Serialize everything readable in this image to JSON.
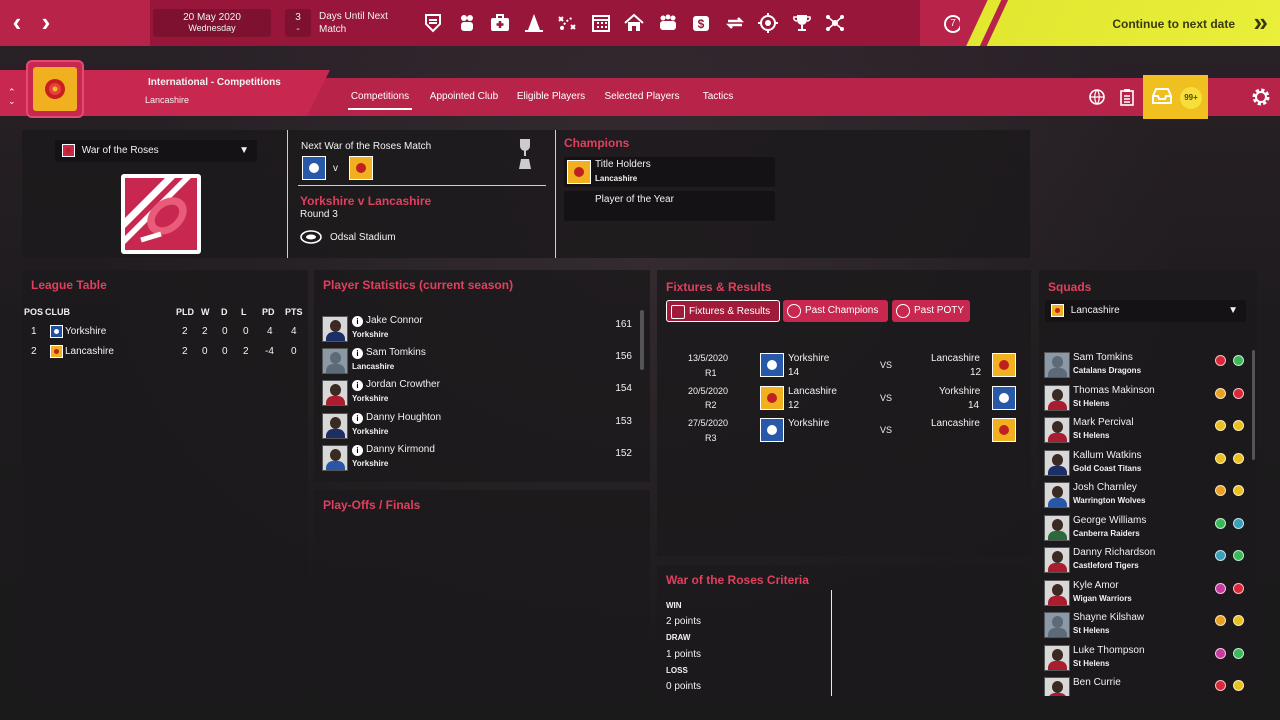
{
  "topbar": {
    "date": "20 May 2020",
    "weekday": "Wednesday",
    "days_until": "3",
    "days_until_dash": "-",
    "days_label": "Days Until Next Match",
    "counter": "7",
    "continue_label": "Continue to next date",
    "icons": [
      "squad-shield-icon",
      "players-icon",
      "medical-icon",
      "training-cone-icon",
      "tactics-icon",
      "calendar-icon",
      "home-icon",
      "staff-icon",
      "finance-icon",
      "transfers-icon",
      "scouting-icon",
      "trophy-icon",
      "club-hierarchy-icon"
    ]
  },
  "context": {
    "title": "International - Competitions",
    "subtitle": "Lancashire"
  },
  "tabs": [
    "Competitions",
    "Appointed Club",
    "Eligible Players",
    "Selected Players",
    "Tactics"
  ],
  "inbox_badge": "99+",
  "competition": {
    "selector": "War of the Roses",
    "next_match_heading": "Next War of the Roses Match",
    "vs": "v",
    "match_title": "Yorkshire v Lancashire",
    "round": "Round 3",
    "venue": "Odsal Stadium"
  },
  "champions": {
    "heading": "Champions",
    "title_holders_label": "Title Holders",
    "title_holders_value": "Lancashire",
    "poty_label": "Player of the Year"
  },
  "league": {
    "heading": "League Table",
    "columns": [
      "POS",
      "CLUB",
      "PLD",
      "W",
      "D",
      "L",
      "PD",
      "PTS"
    ],
    "rows": [
      {
        "pos": "1",
        "club": "Yorkshire",
        "pld": "2",
        "w": "2",
        "d": "0",
        "l": "0",
        "pd": "4",
        "pts": "4"
      },
      {
        "pos": "2",
        "club": "Lancashire",
        "pld": "2",
        "w": "0",
        "d": "0",
        "l": "2",
        "pd": "-4",
        "pts": "0"
      }
    ]
  },
  "player_stats": {
    "heading": "Player Statistics (current season)",
    "rows": [
      {
        "name": "Jake Connor",
        "club": "Yorkshire",
        "value": "161"
      },
      {
        "name": "Sam Tomkins",
        "club": "Lancashire",
        "value": "156"
      },
      {
        "name": "Jordan Crowther",
        "club": "Yorkshire",
        "value": "154"
      },
      {
        "name": "Danny Houghton",
        "club": "Yorkshire",
        "value": "153"
      },
      {
        "name": "Danny Kirmond",
        "club": "Yorkshire",
        "value": "152"
      }
    ]
  },
  "playoffs": {
    "heading": "Play-Offs / Finals"
  },
  "fixtures": {
    "heading": "Fixtures & Results",
    "buttons": [
      "Fixtures & Results",
      "Past Champions",
      "Past POTY"
    ],
    "vs": "VS",
    "rows": [
      {
        "date": "13/5/2020",
        "round": "R1",
        "home": "Yorkshire",
        "home_score": "14",
        "away": "Lancashire",
        "away_score": "12"
      },
      {
        "date": "20/5/2020",
        "round": "R2",
        "home": "Lancashire",
        "home_score": "12",
        "away": "Yorkshire",
        "away_score": "14"
      },
      {
        "date": "27/5/2020",
        "round": "R3",
        "home": "Yorkshire",
        "home_score": "",
        "away": "Lancashire",
        "away_score": ""
      }
    ]
  },
  "criteria": {
    "heading": "War of the Roses Criteria",
    "lines": [
      "WIN",
      "2 points",
      "DRAW",
      "1 points",
      "LOSS",
      "0 points"
    ]
  },
  "squads": {
    "heading": "Squads",
    "selector": "Lancashire",
    "players": [
      {
        "name": "Sam Tomkins",
        "club": "Catalans Dragons",
        "dots": [
          "#d8283a",
          "#3ab85a"
        ]
      },
      {
        "name": "Thomas Makinson",
        "club": "St Helens",
        "dots": [
          "#e8a020",
          "#d8283a"
        ]
      },
      {
        "name": "Mark Percival",
        "club": "St Helens",
        "dots": [
          "#e8c020",
          "#e8c020"
        ]
      },
      {
        "name": "Kallum Watkins",
        "club": "Gold Coast Titans",
        "dots": [
          "#e8c020",
          "#e8c020"
        ]
      },
      {
        "name": "Josh Charnley",
        "club": "Warrington Wolves",
        "dots": [
          "#e8a020",
          "#e8c020"
        ]
      },
      {
        "name": "George Williams",
        "club": "Canberra Raiders",
        "dots": [
          "#3ab85a",
          "#3aa0b8"
        ]
      },
      {
        "name": "Danny Richardson",
        "club": "Castleford Tigers",
        "dots": [
          "#3aa0b8",
          "#3ab85a"
        ]
      },
      {
        "name": "Kyle Amor",
        "club": "Wigan Warriors",
        "dots": [
          "#c83aa0",
          "#d8283a"
        ]
      },
      {
        "name": "Shayne Kilshaw",
        "club": "St Helens",
        "dots": [
          "#e8a020",
          "#e8c020"
        ]
      },
      {
        "name": "Luke Thompson",
        "club": "St Helens",
        "dots": [
          "#c83aa0",
          "#3ab85a"
        ]
      },
      {
        "name": "Ben Currie",
        "club": "",
        "dots": [
          "#d8283a",
          "#e8c020"
        ]
      }
    ]
  }
}
